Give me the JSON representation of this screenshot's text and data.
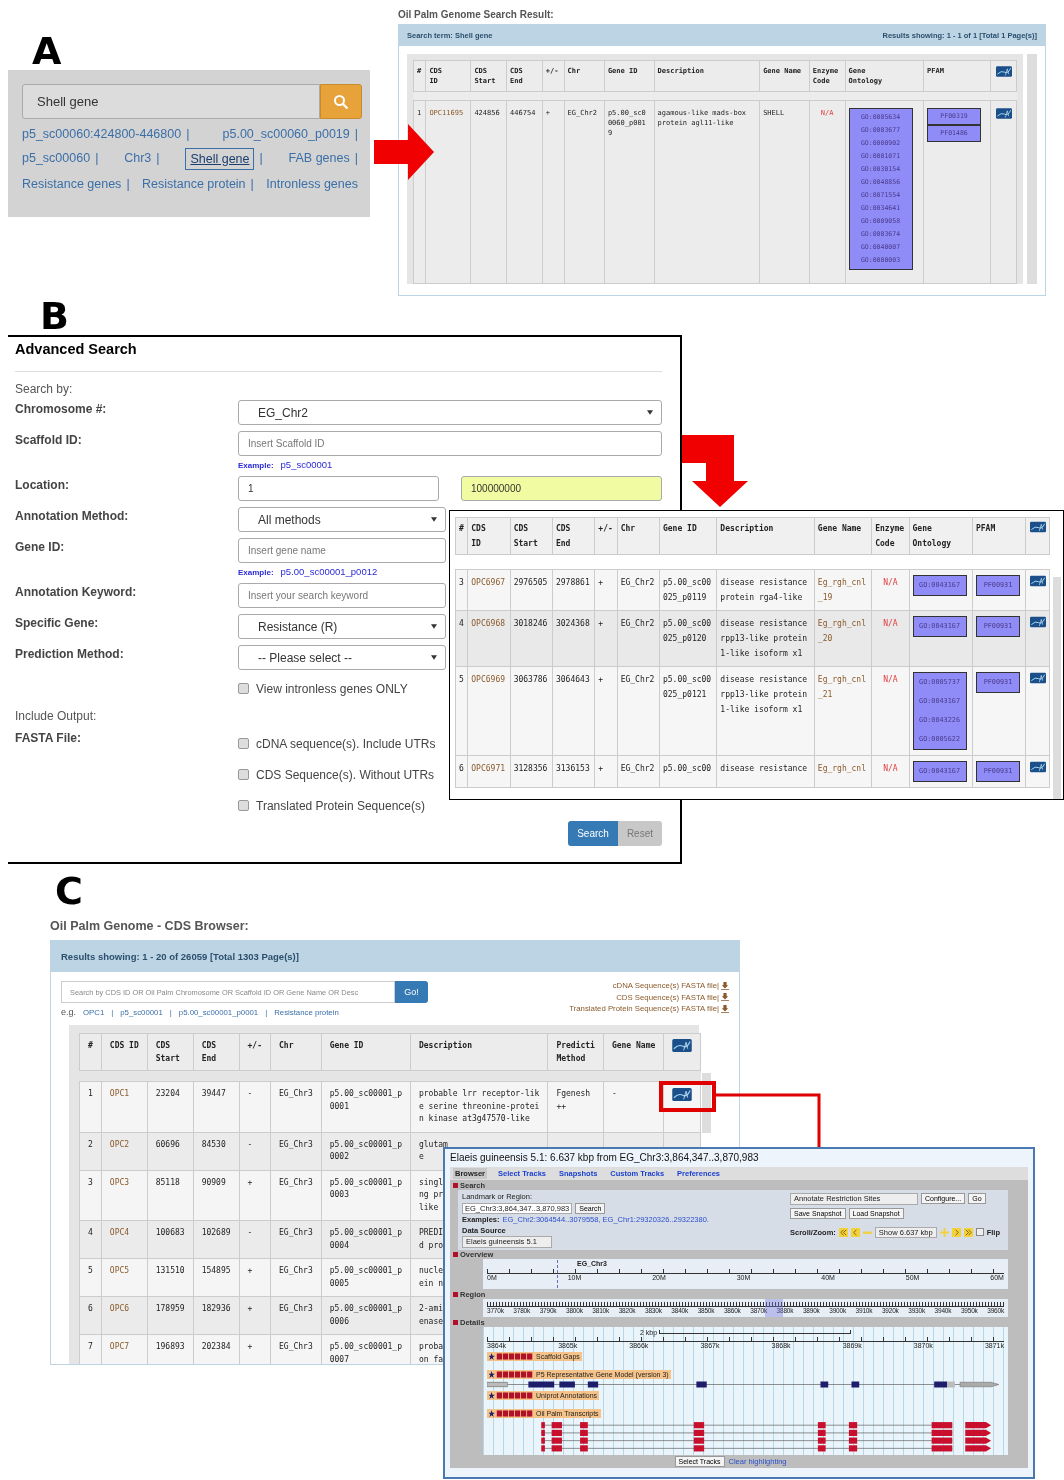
{
  "panel_a": {
    "letter": "A",
    "search": {
      "value": "Shell gene"
    },
    "suggestions": [
      {
        "label": "p5_sc00060:424800-446800",
        "separator": "|",
        "selected": false
      },
      {
        "label": "p5.00_sc00060_p0019",
        "separator": "|",
        "selected": false
      },
      {
        "label": "p5_sc00060",
        "separator": "|",
        "selected": false
      },
      {
        "label": "Chr3",
        "separator": "|",
        "selected": false
      },
      {
        "label": "Shell gene",
        "separator": "|",
        "selected": true
      },
      {
        "label": "FAB genes",
        "separator": "|",
        "selected": false
      },
      {
        "label": "Resistance genes",
        "separator": "|",
        "selected": false
      },
      {
        "label": "Resistance protein",
        "separator": "|",
        "selected": false
      },
      {
        "label": "Intronless genes",
        "selected": false
      }
    ],
    "result": {
      "title": "Oil Palm Genome Search Result:",
      "search_term": "Search term: Shell gene",
      "results_showing": "Results showing: 1 - 1 of 1 [Total 1 Page(s)]",
      "table": {
        "columns": [
          {
            "label": "#",
            "kind": "text"
          },
          {
            "label": "CDS\nID",
            "kind": "link"
          },
          {
            "label": "CDS\nStart",
            "kind": "text"
          },
          {
            "label": "CDS\nEnd",
            "kind": "text"
          },
          {
            "label": "+/-",
            "kind": "text"
          },
          {
            "label": "Chr",
            "kind": "text"
          },
          {
            "label": "Gene ID",
            "kind": "text"
          },
          {
            "label": "Description",
            "kind": "text"
          },
          {
            "label": "Gene Name",
            "kind": "text"
          },
          {
            "label": "Enzyme\nCode",
            "kind": "na"
          },
          {
            "label": "Gene\nOntology",
            "kind": "go"
          },
          {
            "label": "PFAM",
            "kind": "pfam"
          },
          {
            "kind": "icon"
          }
        ],
        "rows": [
          {
            "cells": [
              "1",
              "OPC11695",
              "424856",
              "446754",
              "+",
              "EG_Chr2",
              "p5.00_sc0\n0060_p001\n9",
              "agamous-like mads-box\nprotein agl11-like",
              "SHELL",
              "N/A",
              [
                "GO:0005634",
                "GO:0003677",
                "GO:0000902",
                "GO:0001071",
                "GO:0030154",
                "GO:0048856",
                "GO:0071554",
                "GO:0034641",
                "GO:0009058",
                "GO:0003674",
                "GO:0040007",
                "GO:0000003"
              ],
              [
                "PF00319",
                "PF01486"
              ]
            ],
            "icon": true
          }
        ]
      }
    }
  },
  "panel_b": {
    "letter": "B",
    "title": "Advanced Search",
    "search_by": "Search by:",
    "fields": [
      {
        "label": "Chromosome #:",
        "kind": "select",
        "value": "EG_Chr2"
      },
      {
        "label": "Scaffold ID:",
        "kind": "input",
        "placeholder": "Insert Scaffold ID",
        "example_label": "Example:",
        "example": "p5_sc00001"
      },
      {
        "label": "Location:",
        "kind": "range",
        "from": "1",
        "to": "100000000"
      },
      {
        "label": "Annotation Method:",
        "kind": "select",
        "value": "All methods"
      },
      {
        "label": "Gene ID:",
        "kind": "input",
        "placeholder": "Insert gene name",
        "example_label": "Example:",
        "example": "p5.00_sc00001_p0012"
      },
      {
        "label": "Annotation Keyword:",
        "kind": "input",
        "placeholder": "Insert your search keyword"
      },
      {
        "label": "Specific Gene:",
        "kind": "select",
        "value": "Resistance (R)"
      },
      {
        "label": "Prediction Method:",
        "kind": "select",
        "value": "-- Please select --"
      }
    ],
    "intronless": {
      "label": "View intronless genes ONLY",
      "checked": false
    },
    "include_output": "Include Output:",
    "fasta_label": "FASTA File:",
    "fasta_options": [
      {
        "label": "cDNA sequence(s). Include UTRs",
        "checked": false
      },
      {
        "label": "CDS Sequence(s). Without UTRs",
        "checked": false
      },
      {
        "label": "Translated Protein Sequence(s)",
        "checked": false
      }
    ],
    "buttons": [
      {
        "label": "Search",
        "kind": "primary"
      },
      {
        "label": "Reset",
        "kind": "secondary"
      }
    ],
    "results_table": {
      "columns": [
        {
          "label": "#",
          "kind": "text"
        },
        {
          "label": "CDS\nID",
          "kind": "link"
        },
        {
          "label": "CDS\nStart",
          "kind": "text"
        },
        {
          "label": "CDS\nEnd",
          "kind": "text"
        },
        {
          "label": "+/-",
          "kind": "text"
        },
        {
          "label": "Chr",
          "kind": "text"
        },
        {
          "label": "Gene ID",
          "kind": "text"
        },
        {
          "label": "Description",
          "kind": "text"
        },
        {
          "label": "Gene Name",
          "kind": "link"
        },
        {
          "label": "Enzyme\nCode",
          "kind": "na"
        },
        {
          "label": "Gene\nOntology",
          "kind": "go"
        },
        {
          "label": "PFAM",
          "kind": "pfam"
        },
        {
          "kind": "icon"
        }
      ],
      "rows": [
        {
          "cells": [
            "3",
            "OPC6967",
            "2976505",
            "2978861",
            "+",
            "EG_Chr2",
            "p5.00_sc00\n025_p0119",
            "disease resistance\nprotein rga4-like",
            "Eg_rgh_cnl\n_19",
            "N/A",
            [
              "GO:0043167"
            ],
            [
              "PF00931"
            ]
          ],
          "icon": true
        },
        {
          "cells": [
            "4",
            "OPC6968",
            "3018246",
            "3024368",
            "+",
            "EG_Chr2",
            "p5.00_sc00\n025_p0120",
            "disease resistance\nrpp13-like protein\n1-like isoform x1",
            "Eg_rgh_cnl\n_20",
            "N/A",
            [
              "GO:0043167"
            ],
            [
              "PF00931"
            ]
          ],
          "icon": true
        },
        {
          "cells": [
            "5",
            "OPC6969",
            "3063786",
            "3064643",
            "+",
            "EG_Chr2",
            "p5.00_sc00\n025_p0121",
            "disease resistance\nrpp13-like protein\n1-like isoform x1",
            "Eg_rgh_cnl\n_21",
            "N/A",
            [
              "GO:0005737",
              "GO:0043167",
              "GO:0043226",
              "GO:0005622"
            ],
            [
              "PF00931"
            ]
          ],
          "icon": true
        },
        {
          "cells": [
            "6",
            "OPC6971",
            "3128356",
            "3136153",
            "+",
            "EG_Chr2",
            "p5.00_sc00",
            "disease resistance",
            "Eg_rgh_cnl",
            "N/A",
            [
              "GO:0043167"
            ],
            [
              "PF00931"
            ]
          ],
          "icon": true
        }
      ]
    }
  },
  "panel_c": {
    "letter": "C",
    "title": "Oil Palm Genome - CDS Browser:",
    "results_showing": "Results showing: 1 - 20 of 26059 [Total 1303 Page(s)]",
    "search": {
      "placeholder": "Search by CDS ID OR Oil Palm Chromosome OR Scaffold ID OR Gene Name OR Desc",
      "button": "Go!"
    },
    "examples_label": "e.g.",
    "examples": [
      {
        "label": "OPC1",
        "separator": "|"
      },
      {
        "label": "p5_sc00001",
        "separator": "|"
      },
      {
        "label": "p5.00_sc00001_p0001",
        "separator": "|"
      },
      {
        "label": "Resistance protein"
      }
    ],
    "downloads": [
      "cDNA Sequence(s) FASTA file|",
      "CDS Sequence(s) FASTA file|",
      "Translated Protein Sequence(s) FASTA file|"
    ],
    "table": {
      "columns": [
        {
          "label": "#",
          "kind": "text"
        },
        {
          "label": "CDS ID",
          "kind": "link"
        },
        {
          "label": "CDS\nStart",
          "kind": "text"
        },
        {
          "label": "CDS\nEnd",
          "kind": "text"
        },
        {
          "label": "+/-",
          "kind": "text"
        },
        {
          "label": "Chr",
          "kind": "text"
        },
        {
          "label": "Gene ID",
          "kind": "text"
        },
        {
          "label": "Description",
          "kind": "text"
        },
        {
          "label": "Predicti\nMethod",
          "kind": "text"
        },
        {
          "label": "Gene Name",
          "kind": "text"
        },
        {
          "kind": "icon"
        }
      ],
      "rows": [
        {
          "cells": [
            "1",
            "OPC1",
            "23204",
            "39447",
            "-",
            "EG_Chr3",
            "p5.00_sc00001_p\n0001",
            "probable lrr receptor-lik\ne serine threonine-protei\nn kinase at3g47570-like",
            "Fgenesh\n++",
            "-"
          ],
          "icon": true
        },
        {
          "cells": [
            "2",
            "OPC2",
            "60696",
            "84530",
            "-",
            "EG_Chr3",
            "p5.00_sc00001_p\n0002",
            "glutam\ne"
          ],
          "icon": false
        },
        {
          "cells": [
            "3",
            "OPC3",
            "85118",
            "90909",
            "+",
            "EG_Chr3",
            "p5.00_sc00001_p\n0003",
            "singl\nng pr\nlike"
          ],
          "icon": false
        },
        {
          "cells": [
            "4",
            "OPC4",
            "100683",
            "102689",
            "-",
            "EG_Chr3",
            "p5.00_sc00001_p\n0004",
            "PREDI\nd pro"
          ],
          "icon": false
        },
        {
          "cells": [
            "5",
            "OPC5",
            "131510",
            "154895",
            "+",
            "EG_Chr3",
            "p5.00_sc00001_p\n0005",
            "nucle\nein n"
          ],
          "icon": false
        },
        {
          "cells": [
            "6",
            "OPC6",
            "178959",
            "182936",
            "+",
            "EG_Chr3",
            "p5.00_sc00001_p\n0006",
            "2-ami\nenase"
          ],
          "icon": false
        },
        {
          "cells": [
            "7",
            "OPC7",
            "196893",
            "202384",
            "+",
            "EG_Chr3",
            "p5.00_sc00001_p\n0007",
            "proba\non fa"
          ],
          "icon": false
        }
      ]
    },
    "browser": {
      "title": "Elaeis guineensis 5.1: 6.637 kbp from EG_Chr3:3,864,347..3,870,983",
      "tabs": [
        {
          "label": "Browser",
          "selected": true
        },
        {
          "label": "Select Tracks",
          "selected": false
        },
        {
          "label": "Snapshots",
          "selected": false
        },
        {
          "label": "Custom Tracks",
          "selected": false
        },
        {
          "label": "Preferences",
          "selected": false
        }
      ],
      "search": {
        "section": "Search",
        "landmark_label": "Landmark or Region:",
        "landmark_value": "EG_Chr3:3,864,347..3,870,983",
        "search_button": "Search",
        "examples_label": "Examples:",
        "examples": "EG_Chr2:3064544..3079558, EG_Chr1:29320326..29322380.",
        "data_source_label": "Data Source",
        "data_source": "Elaeis guineensis 5.1",
        "plugin": "Annotate Restriction Sites",
        "configure": "Configure...",
        "go": "Go",
        "save_snapshot": "Save Snapshot",
        "load_snapshot": "Load Snapshot",
        "scroll_zoom": "Scroll/Zoom:",
        "zoom_select": "Show 6.637 kbp",
        "flip": {
          "label": "Flip",
          "checked": false
        }
      },
      "overview": {
        "section": "Overview",
        "chromosome": "EG_Chr3",
        "ticks": [
          "0M",
          "10M",
          "20M",
          "30M",
          "40M",
          "50M",
          "60M"
        ]
      },
      "region": {
        "section": "Region",
        "ticks": [
          "3770k",
          "3780k",
          "3790k",
          "3800k",
          "3810k",
          "3820k",
          "3830k",
          "3840k",
          "3850k",
          "3860k",
          "3870k",
          "3880k",
          "3890k",
          "3900k",
          "3910k",
          "3920k",
          "3930k",
          "3940k",
          "3950k",
          "3960k"
        ]
      },
      "details": {
        "section": "Details",
        "scale": "2 kbp",
        "ticks": [
          "3864k",
          "3865k",
          "3866k",
          "3867k",
          "3868k",
          "3869k",
          "3870k",
          "3871k"
        ],
        "tracks": [
          {
            "name": "Scaffold Gaps",
            "kind": "empty"
          },
          {
            "name": "P5 Representative Gene Model (version 3)",
            "kind": "gene"
          },
          {
            "name": "Uniprot Annotations",
            "kind": "empty"
          },
          {
            "name": "Oil Palm Transcripts",
            "kind": "transcripts"
          }
        ]
      },
      "footer": {
        "select_tracks": "Select Tracks",
        "clear": "Clear highlighting"
      }
    }
  }
}
